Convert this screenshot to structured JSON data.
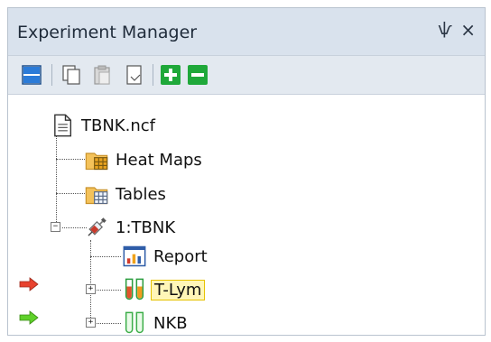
{
  "panel": {
    "title": "Experiment Manager",
    "pin_glyph": "ѱ",
    "close_glyph": "×"
  },
  "toolbar": {
    "buttons": [
      {
        "icon": "layout-icon"
      },
      {
        "icon": "copy-icon"
      },
      {
        "icon": "paste-icon"
      },
      {
        "icon": "duplicate-icon"
      },
      {
        "icon": "add-icon"
      },
      {
        "icon": "remove-icon"
      }
    ]
  },
  "tree": {
    "root": {
      "label": "TBNK.ncf",
      "icon": "document-icon"
    },
    "heat_maps": {
      "label": "Heat Maps",
      "icon": "heatmap-folder-icon"
    },
    "tables": {
      "label": "Tables",
      "icon": "table-folder-icon"
    },
    "experiment": {
      "label": "1:TBNK",
      "icon": "syringe-icon",
      "expander": "−"
    },
    "report": {
      "label": "Report",
      "icon": "report-icon"
    },
    "tlym": {
      "label": "T-Lym",
      "icon": "tubes-orange-icon",
      "expander": "+",
      "selected": true
    },
    "nkb": {
      "label": "NKB",
      "icon": "tubes-green-icon",
      "expander": "+"
    }
  },
  "markers": {
    "red_arrow_color": "#e8422e",
    "green_arrow_color": "#5fd12a"
  },
  "colors": {
    "titlebar": "#d9e2ed",
    "toolbar": "#e3e9f0",
    "selection": "#fff6b8",
    "add_button": "#1fa83a",
    "remove_button": "#1fa83a"
  }
}
